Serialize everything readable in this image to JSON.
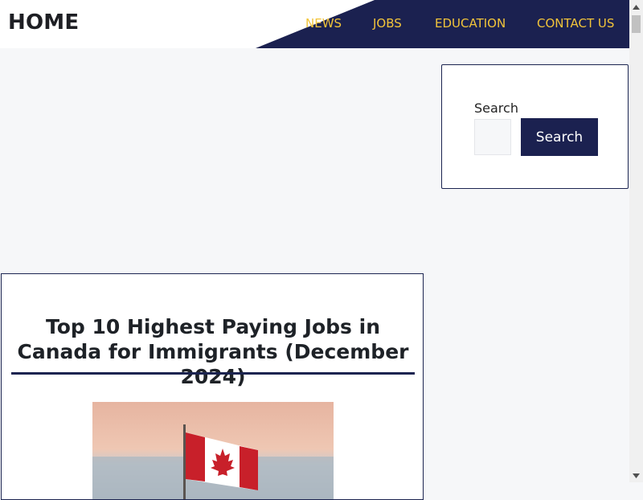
{
  "site": {
    "logo_text": "HOME"
  },
  "nav": {
    "items": [
      {
        "label": "NEWS"
      },
      {
        "label": "JOBS"
      },
      {
        "label": "EDUCATION"
      },
      {
        "label": "CONTACT US"
      }
    ]
  },
  "sidebar": {
    "search_widget": {
      "label": "Search",
      "input_value": "",
      "button_label": "Search"
    }
  },
  "article": {
    "title": "Top 10 Highest Paying Jobs in Canada for Immigrants (December 2024)"
  },
  "colors": {
    "nav_background": "#1b2150",
    "nav_text": "#f2c43a",
    "page_background": "#f6f7f9",
    "accent": "#1b2450"
  },
  "icons": {
    "scroll_up": "triangle-up-icon",
    "scroll_down": "triangle-down-icon"
  }
}
